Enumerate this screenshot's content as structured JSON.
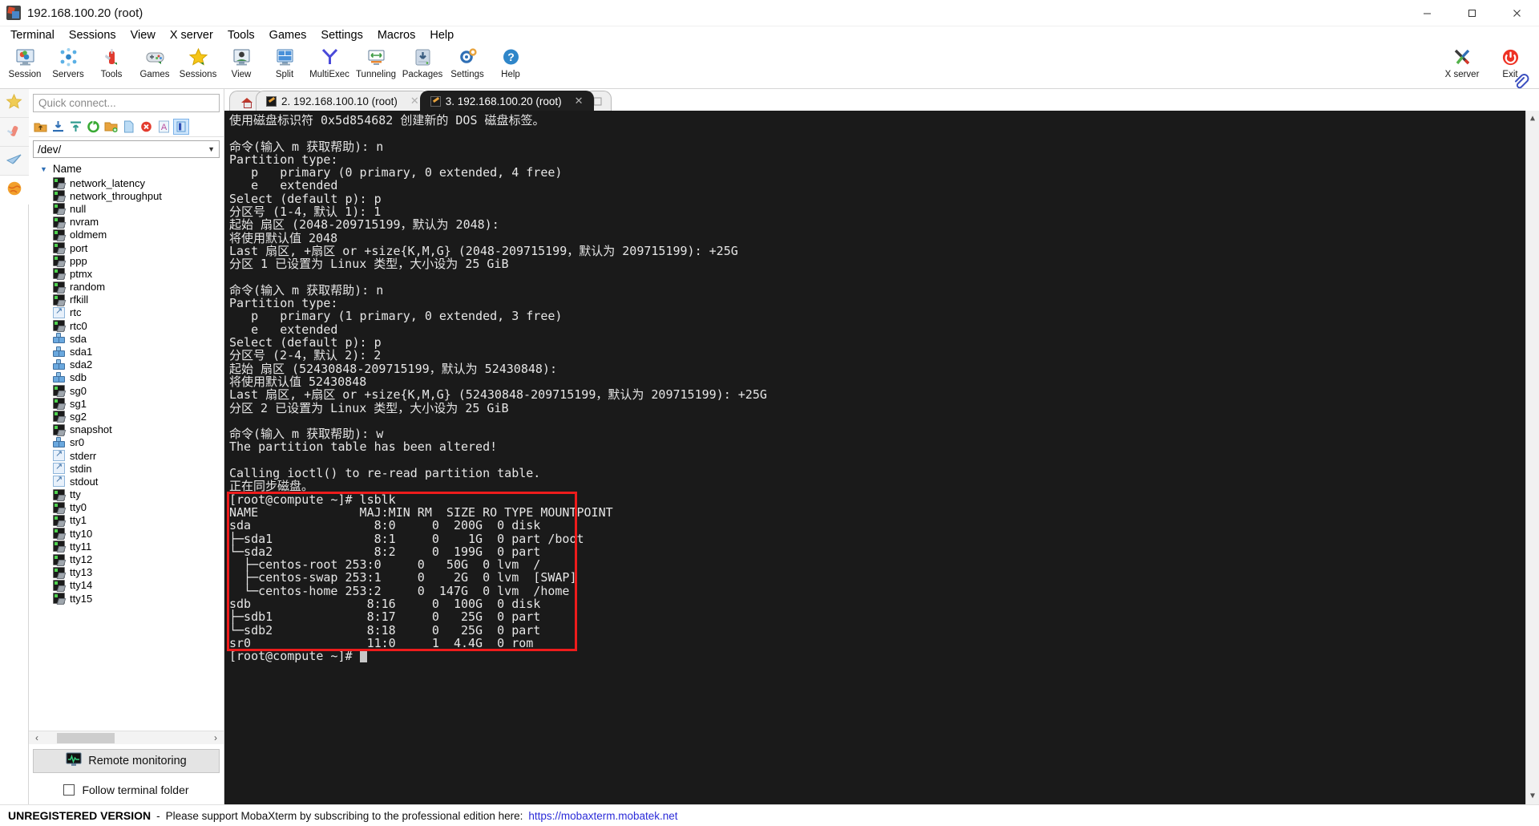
{
  "window": {
    "title": "192.168.100.20 (root)",
    "app_icon": "mobaxterm-icon",
    "buttons": {
      "minimize": "minimize-icon",
      "maximize": "maximize-icon",
      "close": "close-icon"
    }
  },
  "menubar": {
    "items": [
      "Terminal",
      "Sessions",
      "View",
      "X server",
      "Tools",
      "Games",
      "Settings",
      "Macros",
      "Help"
    ]
  },
  "toolbar": {
    "items": [
      {
        "label": "Session",
        "icon": "session-icon"
      },
      {
        "label": "Servers",
        "icon": "servers-icon"
      },
      {
        "label": "Tools",
        "icon": "tools-icon"
      },
      {
        "label": "Games",
        "icon": "games-icon"
      },
      {
        "label": "Sessions",
        "icon": "sessions-star-icon"
      },
      {
        "label": "View",
        "icon": "view-icon"
      },
      {
        "label": "Split",
        "icon": "split-icon"
      },
      {
        "label": "MultiExec",
        "icon": "multiexec-icon"
      },
      {
        "label": "Tunneling",
        "icon": "tunneling-icon"
      },
      {
        "label": "Packages",
        "icon": "packages-icon"
      },
      {
        "label": "Settings",
        "icon": "settings-gear-icon"
      },
      {
        "label": "Help",
        "icon": "help-icon"
      }
    ],
    "right_items": [
      {
        "label": "X server",
        "icon": "x-server-icon"
      },
      {
        "label": "Exit",
        "icon": "exit-power-icon"
      }
    ]
  },
  "rail": {
    "items": [
      {
        "name": "favorites",
        "icon": "star-icon"
      },
      {
        "name": "tools",
        "icon": "swiss-knife-icon"
      },
      {
        "name": "send",
        "icon": "paper-plane-icon"
      },
      {
        "name": "globe",
        "icon": "globe-icon"
      }
    ]
  },
  "sidebar": {
    "quick_connect_placeholder": "Quick connect...",
    "file_toolbar": [
      "up-folder-icon",
      "download-icon",
      "upload-icon",
      "refresh-icon",
      "new-folder-icon",
      "new-file-icon",
      "delete-icon",
      "text-mode-icon",
      "view-mode-icon"
    ],
    "path": "/dev/",
    "column_header": "Name",
    "files": [
      {
        "name": "network_latency",
        "icon": "device-icon"
      },
      {
        "name": "network_throughput",
        "icon": "device-icon"
      },
      {
        "name": "null",
        "icon": "device-icon"
      },
      {
        "name": "nvram",
        "icon": "device-icon"
      },
      {
        "name": "oldmem",
        "icon": "device-icon"
      },
      {
        "name": "port",
        "icon": "device-icon"
      },
      {
        "name": "ppp",
        "icon": "device-icon"
      },
      {
        "name": "ptmx",
        "icon": "device-icon"
      },
      {
        "name": "random",
        "icon": "device-icon"
      },
      {
        "name": "rfkill",
        "icon": "device-icon"
      },
      {
        "name": "rtc",
        "icon": "shortcut-icon"
      },
      {
        "name": "rtc0",
        "icon": "device-icon"
      },
      {
        "name": "sda",
        "icon": "disk-icon"
      },
      {
        "name": "sda1",
        "icon": "disk-icon"
      },
      {
        "name": "sda2",
        "icon": "disk-icon"
      },
      {
        "name": "sdb",
        "icon": "disk-icon"
      },
      {
        "name": "sg0",
        "icon": "device-icon"
      },
      {
        "name": "sg1",
        "icon": "device-icon"
      },
      {
        "name": "sg2",
        "icon": "device-icon"
      },
      {
        "name": "snapshot",
        "icon": "device-icon"
      },
      {
        "name": "sr0",
        "icon": "disk-icon"
      },
      {
        "name": "stderr",
        "icon": "shortcut-icon"
      },
      {
        "name": "stdin",
        "icon": "shortcut-icon"
      },
      {
        "name": "stdout",
        "icon": "shortcut-icon"
      },
      {
        "name": "tty",
        "icon": "device-icon"
      },
      {
        "name": "tty0",
        "icon": "device-icon"
      },
      {
        "name": "tty1",
        "icon": "device-icon"
      },
      {
        "name": "tty10",
        "icon": "device-icon"
      },
      {
        "name": "tty11",
        "icon": "device-icon"
      },
      {
        "name": "tty12",
        "icon": "device-icon"
      },
      {
        "name": "tty13",
        "icon": "device-icon"
      },
      {
        "name": "tty14",
        "icon": "device-icon"
      },
      {
        "name": "tty15",
        "icon": "device-icon"
      }
    ],
    "remote_monitoring_label": "Remote monitoring",
    "follow_terminal_folder_label": "Follow terminal folder",
    "follow_terminal_folder_checked": false
  },
  "tabs": {
    "home_label": "",
    "items": [
      {
        "label": "2. 192.168.100.10 (root)",
        "active": false,
        "closable": true
      },
      {
        "label": "3. 192.168.100.20 (root)",
        "active": true,
        "closable": true
      }
    ]
  },
  "terminal": {
    "prompt": "[root@compute ~]#",
    "content": "使用磁盘标识符 0x5d854682 创建新的 DOS 磁盘标签。\n\n命令(输入 m 获取帮助): n\nPartition type:\n   p   primary (0 primary, 0 extended, 4 free)\n   e   extended\nSelect (default p): p\n分区号 (1-4，默认 1): 1\n起始 扇区 (2048-209715199，默认为 2048):\n将使用默认值 2048\nLast 扇区, +扇区 or +size{K,M,G} (2048-209715199，默认为 209715199): +25G\n分区 1 已设置为 Linux 类型，大小设为 25 GiB\n\n命令(输入 m 获取帮助): n\nPartition type:\n   p   primary (1 primary, 0 extended, 3 free)\n   e   extended\nSelect (default p): p\n分区号 (2-4，默认 2): 2\n起始 扇区 (52430848-209715199，默认为 52430848):\n将使用默认值 52430848\nLast 扇区, +扇区 or +size{K,M,G} (52430848-209715199，默认为 209715199): +25G\n分区 2 已设置为 Linux 类型，大小设为 25 GiB\n\n命令(输入 m 获取帮助): w\nThe partition table has been altered!\n\nCalling ioctl() to re-read partition table.\n正在同步磁盘。",
    "highlighted_block": "[root@compute ~]# lsblk\nNAME              MAJ:MIN RM  SIZE RO TYPE MOUNTPOINT\nsda                 8:0     0  200G  0 disk\n├─sda1              8:1     0    1G  0 part /boot\n└─sda2              8:2     0  199G  0 part\n  ├─centos-root 253:0     0   50G  0 lvm  /\n  ├─centos-swap 253:1     0    2G  0 lvm  [SWAP]\n  └─centos-home 253:2     0  147G  0 lvm  /home\nsdb                8:16     0  100G  0 disk\n├─sdb1             8:17     0   25G  0 part\n└─sdb2             8:18     0   25G  0 part\nsr0                11:0     1  4.4G  0 rom",
    "final_prompt": "[root@compute ~]# ",
    "highlight_color": "#ee1c1c",
    "background": "#1a1a1a",
    "foreground": "#e6e6e6"
  },
  "lsblk_table": {
    "columns": [
      "NAME",
      "MAJ:MIN",
      "RM",
      "SIZE",
      "RO",
      "TYPE",
      "MOUNTPOINT"
    ],
    "rows": [
      {
        "NAME": "sda",
        "MAJ:MIN": "8:0",
        "RM": "0",
        "SIZE": "200G",
        "RO": "0",
        "TYPE": "disk",
        "MOUNTPOINT": ""
      },
      {
        "NAME": "├─sda1",
        "MAJ:MIN": "8:1",
        "RM": "0",
        "SIZE": "1G",
        "RO": "0",
        "TYPE": "part",
        "MOUNTPOINT": "/boot"
      },
      {
        "NAME": "└─sda2",
        "MAJ:MIN": "8:2",
        "RM": "0",
        "SIZE": "199G",
        "RO": "0",
        "TYPE": "part",
        "MOUNTPOINT": ""
      },
      {
        "NAME": "  ├─centos-root",
        "MAJ:MIN": "253:0",
        "RM": "0",
        "SIZE": "50G",
        "RO": "0",
        "TYPE": "lvm",
        "MOUNTPOINT": "/"
      },
      {
        "NAME": "  ├─centos-swap",
        "MAJ:MIN": "253:1",
        "RM": "0",
        "SIZE": "2G",
        "RO": "0",
        "TYPE": "lvm",
        "MOUNTPOINT": "[SWAP]"
      },
      {
        "NAME": "  └─centos-home",
        "MAJ:MIN": "253:2",
        "RM": "0",
        "SIZE": "147G",
        "RO": "0",
        "TYPE": "lvm",
        "MOUNTPOINT": "/home"
      },
      {
        "NAME": "sdb",
        "MAJ:MIN": "8:16",
        "RM": "0",
        "SIZE": "100G",
        "RO": "0",
        "TYPE": "disk",
        "MOUNTPOINT": ""
      },
      {
        "NAME": "├─sdb1",
        "MAJ:MIN": "8:17",
        "RM": "0",
        "SIZE": "25G",
        "RO": "0",
        "TYPE": "part",
        "MOUNTPOINT": ""
      },
      {
        "NAME": "└─sdb2",
        "MAJ:MIN": "8:18",
        "RM": "0",
        "SIZE": "25G",
        "RO": "0",
        "TYPE": "part",
        "MOUNTPOINT": ""
      },
      {
        "NAME": "sr0",
        "MAJ:MIN": "11:0",
        "RM": "1",
        "SIZE": "4.4G",
        "RO": "0",
        "TYPE": "rom",
        "MOUNTPOINT": ""
      }
    ]
  },
  "statusbar": {
    "unregistered": "UNREGISTERED VERSION",
    "dash": "-",
    "message": "Please support MobaXterm by subscribing to the professional edition here:",
    "link": "https://mobaxterm.mobatek.net"
  }
}
